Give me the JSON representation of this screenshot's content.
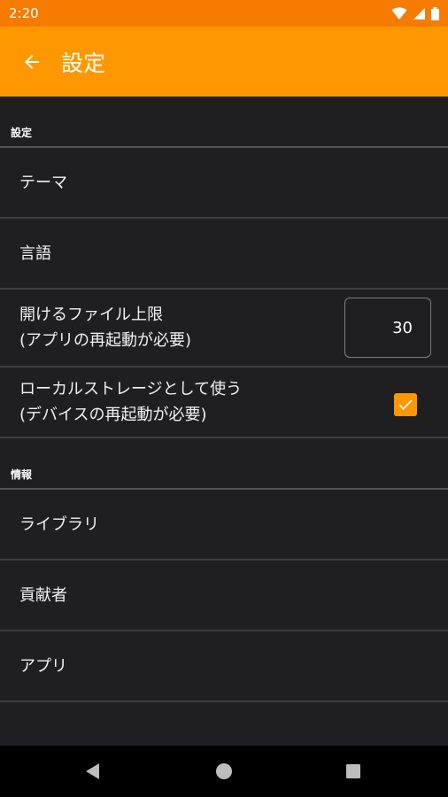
{
  "status_bar": {
    "time": "2:20"
  },
  "app_bar": {
    "title": "設定"
  },
  "sections": {
    "settings": {
      "header": "設定",
      "theme_label": "テーマ",
      "language_label": "言語",
      "file_limit_line1": "開けるファイル上限",
      "file_limit_line2": "(アプリの再起動が必要)",
      "file_limit_value": "30",
      "local_storage_line1": "ローカルストレージとして使う",
      "local_storage_line2": "(デバイスの再起動が必要)",
      "local_storage_checked": true
    },
    "info": {
      "header": "情報",
      "library_label": "ライブラリ",
      "contributors_label": "貢献者",
      "app_label": "アプリ"
    }
  },
  "colors": {
    "status_bar": "#f57c00",
    "app_bar": "#ff9800",
    "background": "#1f1f21",
    "accent": "#ff9800"
  },
  "icons": [
    "wifi-icon",
    "signal-icon",
    "battery-icon",
    "back-arrow-icon",
    "check-icon",
    "nav-back-icon",
    "nav-home-icon",
    "nav-recents-icon"
  ]
}
